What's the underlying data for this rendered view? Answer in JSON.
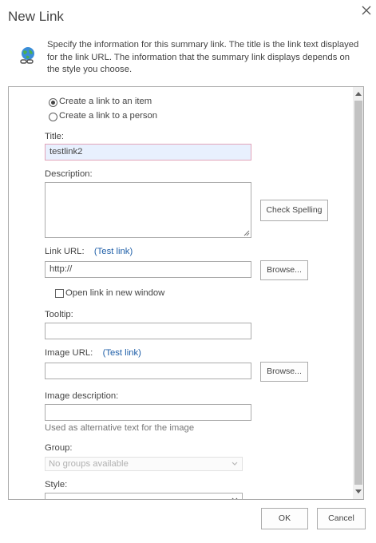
{
  "dialog": {
    "title": "New Link",
    "intro": "Specify the information for this summary link. The title is the link text displayed for the link URL. The information that the summary link displays depends on the style you choose."
  },
  "icons": {
    "close": "close-icon",
    "header": "globe-link-icon",
    "scroll_up": "chevron-up-icon",
    "scroll_down": "chevron-down-icon",
    "dropdown": "chevron-down-icon",
    "resize": "resize-grip-icon"
  },
  "form": {
    "link_type": {
      "options": [
        "Create a link to an item",
        "Create a link to a person"
      ],
      "selected": "Create a link to an item"
    },
    "title": {
      "label": "Title:",
      "value": "testlink2"
    },
    "description": {
      "label": "Description:",
      "value": ""
    },
    "check_spelling": "Check Spelling",
    "link_url": {
      "label": "Link URL:",
      "test_link": "(Test link)",
      "value": "http://",
      "browse": "Browse..."
    },
    "open_new_window": {
      "label": "Open link in new window",
      "checked": false
    },
    "tooltip": {
      "label": "Tooltip:",
      "value": ""
    },
    "image_url": {
      "label": "Image URL:",
      "test_link": "(Test link)",
      "value": "",
      "browse": "Browse..."
    },
    "image_description": {
      "label": "Image description:",
      "value": "",
      "hint": "Used as alternative text for the image"
    },
    "group": {
      "label": "Group:",
      "value": "No groups available",
      "disabled": true
    },
    "style": {
      "label": "Style:"
    }
  },
  "footer": {
    "ok": "OK",
    "cancel": "Cancel"
  },
  "colors": {
    "link": "#1f5fa8",
    "text": "#444444",
    "border": "#ababab",
    "focus_border": "#e2a4b9",
    "focus_fill": "#e8f0fe",
    "scroll_thumb": "#c2c2c2"
  }
}
